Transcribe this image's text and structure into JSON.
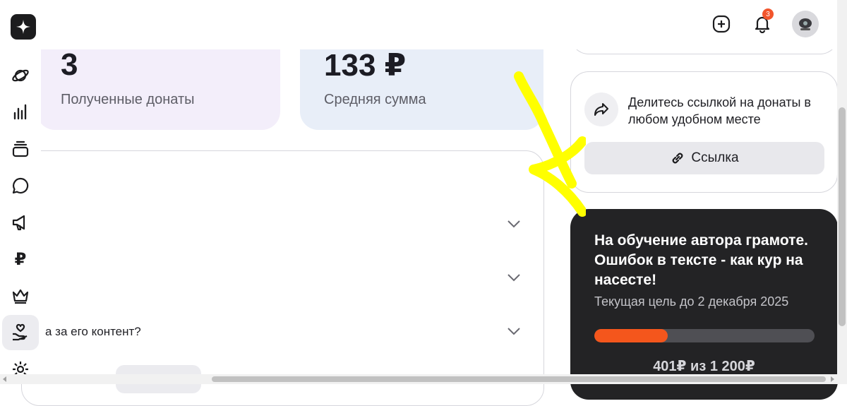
{
  "header": {
    "notifications_count": "3"
  },
  "stats": [
    {
      "value": "3",
      "label": "Полученные донаты"
    },
    {
      "value": "133 ₽",
      "label": "Средняя сумма"
    }
  ],
  "faq": {
    "items": [
      {
        "text": ""
      },
      {
        "text": ""
      },
      {
        "text": "а за его контент?"
      }
    ]
  },
  "nav": {
    "ruble_glyph": "₽"
  },
  "share": {
    "text": "Делитесь ссылкой на донаты в любом удобном месте",
    "link_label": "Ссылка"
  },
  "goal": {
    "title": "На обучение автора грамоте. Ошибок в тексте - как кур на насесте!",
    "subtitle": "Текущая цель до 2 декабря 2025",
    "amount": "401₽ из 1 200₽",
    "progress_fraction": 0.334
  },
  "colors": {
    "stat_purple": "#f3eefa",
    "stat_blue": "#e8eef8",
    "progress": "#f4561c",
    "badge": "#f2552c",
    "annotation": "#ffff00"
  }
}
